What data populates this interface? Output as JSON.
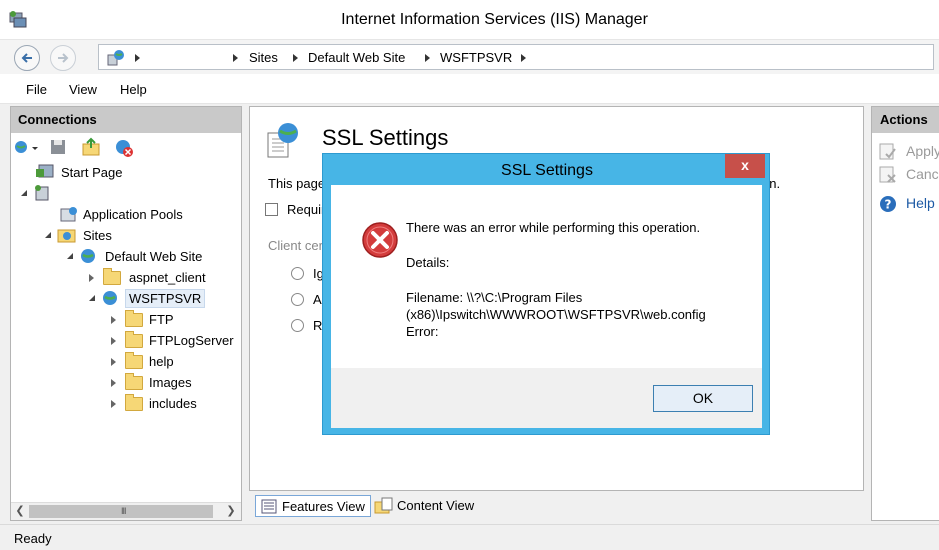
{
  "window": {
    "title": "Internet Information Services (IIS) Manager"
  },
  "address": {
    "crumbs": [
      "Sites",
      "Default Web Site",
      "WSFTPSVR"
    ]
  },
  "menu": {
    "items": [
      "File",
      "View",
      "Help"
    ]
  },
  "connections": {
    "header": "Connections",
    "tree": {
      "start_page": "Start Page",
      "app_pools": "Application Pools",
      "sites": "Sites",
      "default_site": "Default Web Site",
      "aspnet_client": "aspnet_client",
      "wsftpsvr": "WSFTPSVR",
      "folders": [
        "FTP",
        "FTPLogServer",
        "help",
        "Images",
        "includes"
      ]
    },
    "scroll_grip": "III"
  },
  "content": {
    "title": "SSL Settings",
    "desc_start": "This page",
    "desc_end": "on.",
    "require_label": "Requir",
    "client_certs_label": "Client cer",
    "radios": [
      "Ig",
      "A",
      "R"
    ]
  },
  "view_tabs": {
    "features": "Features View",
    "content": "Content View"
  },
  "actions": {
    "header": "Actions",
    "apply": "Apply",
    "cancel": "Canc",
    "help": "Help"
  },
  "status": {
    "text": "Ready"
  },
  "dialog": {
    "title": "SSL Settings",
    "close": "x",
    "message": "There was an error while performing this operation.",
    "details_label": "Details:",
    "filename_line1": "Filename: \\\\?\\C:\\Program Files",
    "filename_line2": "(x86)\\Ipswitch\\WWWROOT\\WSFTPSVR\\web.config",
    "error_label": "Error:",
    "ok": "OK"
  }
}
